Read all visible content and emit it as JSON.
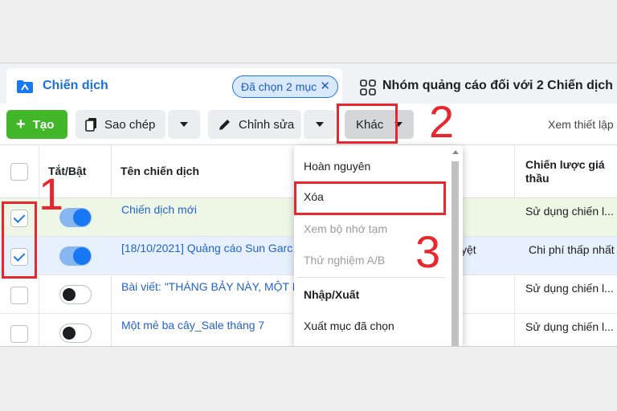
{
  "tabs": {
    "campaign": "Chiến dịch",
    "selected_badge": "Đã chọn 2 mục",
    "selected_close": "✕",
    "ad_groups": "Nhóm quảng cáo đối với 2 Chiến dịch"
  },
  "toolbar": {
    "create_label": "Tạo",
    "create_plus": "+",
    "copy_label": "Sao chép",
    "edit_label": "Chỉnh sửa",
    "more_label": "Khác",
    "view_setup": "Xem thiết lập"
  },
  "table": {
    "headers": {
      "toggle": "Tắt/Bật",
      "name": "Tên chiến dịch",
      "bid_strategy": "Chiến lược giá thầu"
    },
    "rows": [
      {
        "name": "Chiến dịch mới",
        "extra": "",
        "bid": "Sử dụng chiến l...",
        "checked": true,
        "on": true
      },
      {
        "name": "[18/10/2021] Quảng cáo Sun Garc",
        "extra": "yệt",
        "bid": "Chi phí thấp nhất",
        "checked": true,
        "on": true
      },
      {
        "name": "Bài viết: \"THÁNG BẢY NÀY, MỘT M",
        "extra": "",
        "bid": "Sử dụng chiến l...",
        "checked": false,
        "on": false
      },
      {
        "name": "Một mẻ ba cây_Sale tháng 7",
        "extra": "",
        "bid": "Sử dụng chiến l...",
        "checked": false,
        "on": false
      }
    ]
  },
  "menu": {
    "revert": "Hoàn nguyên",
    "delete": "Xóa",
    "view_cache": "Xem bộ nhớ tạm",
    "ab_test": "Thử nghiệm A/B",
    "import_export": "Nhập/Xuất",
    "export_selected": "Xuất mục đã chọn"
  },
  "annotations": {
    "step1": "1",
    "step2": "2",
    "step3": "3"
  },
  "colors": {
    "accent": "#1877f2",
    "create_green": "#42b72a",
    "annotation_red": "#e8262d",
    "row_selected_green": "#eef7e6",
    "row_selected_blue": "#e7f0fd"
  }
}
